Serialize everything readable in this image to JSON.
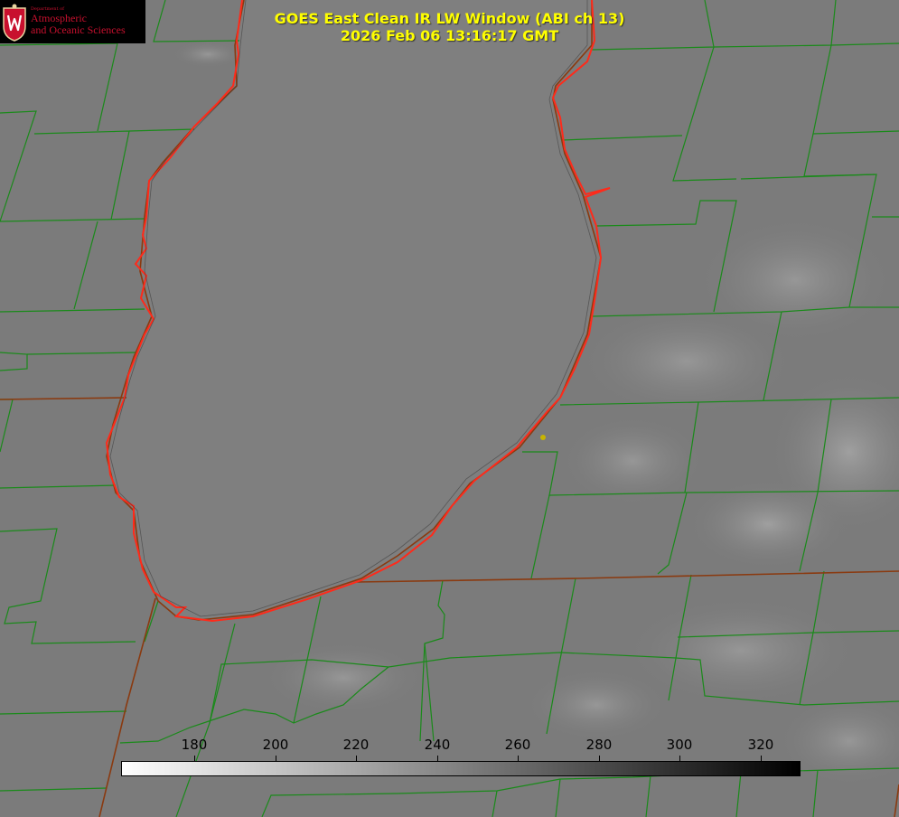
{
  "logo": {
    "department": "Department of",
    "line1": "Atmospheric",
    "line2": "and Oceanic Sciences",
    "color": "#c8102e"
  },
  "title": {
    "line1": "GOES East Clean IR LW Window (ABI ch 13)",
    "line2": "2026 Feb 06 13:16:17 GMT",
    "color": "#ffff00"
  },
  "map": {
    "background_color": "#7b7b7b",
    "county_border_color": "#1a8a1a",
    "state_border_color": "#8a3a10",
    "coastline_color": "#ff2a1a",
    "station_marker_color": "#c8b400"
  },
  "colorbar": {
    "min_color": "#ffffff",
    "max_color": "#000000",
    "ticks": [
      "180",
      "200",
      "220",
      "240",
      "260",
      "280",
      "300",
      "320"
    ]
  }
}
